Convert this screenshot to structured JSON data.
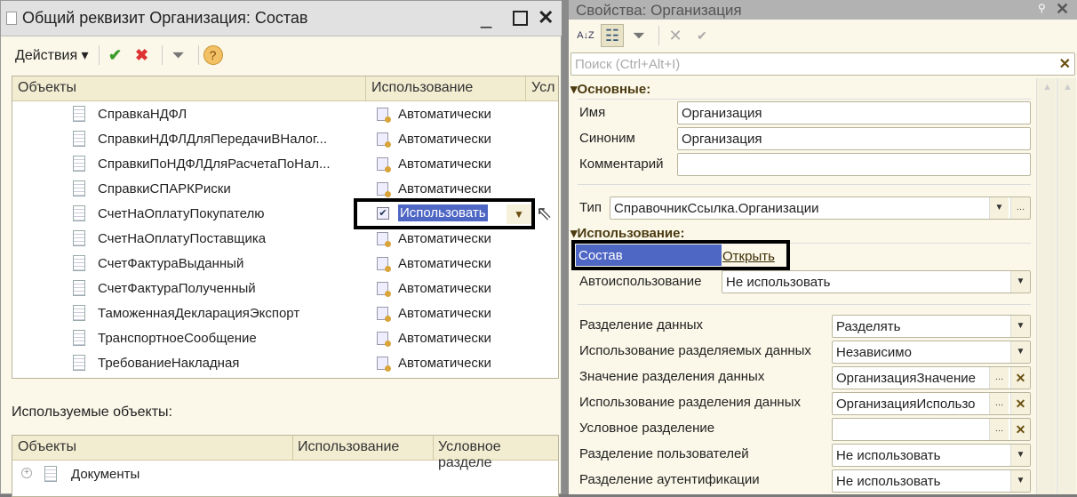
{
  "left_window": {
    "title": "Общий реквизит Организация: Состав",
    "toolbar": {
      "actions": "Действия ▾"
    },
    "grid": {
      "headers": [
        "Объекты",
        "Использование",
        "Усл"
      ],
      "rows": [
        {
          "name": "СправкаНДФЛ",
          "use": "Автоматически"
        },
        {
          "name": "СправкиНДФЛДляПередачиВНалог...",
          "use": "Автоматически"
        },
        {
          "name": "СправкиПоНДФЛДляРасчетаПоНал...",
          "use": "Автоматически"
        },
        {
          "name": "СправкиСПАРКРиски",
          "use": "Автоматически"
        },
        {
          "name": "СчетНаОплатуПокупателю",
          "use": "Использовать"
        },
        {
          "name": "СчетНаОплатуПоставщика",
          "use": "Автоматически"
        },
        {
          "name": "СчетФактураВыданный",
          "use": "Автоматически"
        },
        {
          "name": "СчетФактураПолученный",
          "use": "Автоматически"
        },
        {
          "name": "ТаможеннаяДекларацияЭкспорт",
          "use": "Автоматически"
        },
        {
          "name": "ТранспортноеСообщение",
          "use": "Автоматически"
        },
        {
          "name": "ТребованиеНакладная",
          "use": "Автоматически"
        }
      ]
    },
    "used_label": "Используемые объекты:",
    "used_grid": {
      "headers": [
        "Объекты",
        "Использование",
        "Условное разделе"
      ],
      "rows": [
        {
          "name": "Документы"
        }
      ]
    }
  },
  "right_window": {
    "title": "Свойства: Организация",
    "search_placeholder": "Поиск (Ctrl+Alt+I)",
    "sections": {
      "main": "Основные:",
      "usage": "Использование:"
    },
    "fields": {
      "name_label": "Имя",
      "name": "Организация",
      "synonym_label": "Синоним",
      "synonym": "Организация",
      "comment_label": "Комментарий",
      "comment": "",
      "type_label": "Тип",
      "type": "СправочникСсылка.Организации",
      "composition_label": "Состав",
      "composition_link": "Открыть",
      "autouse_label": "Автоиспользование",
      "autouse": "Не использовать"
    },
    "separation": [
      {
        "label": "Разделение данных",
        "value": "Разделять",
        "kind": "select"
      },
      {
        "label": "Использование разделяемых данных",
        "value": "Независимо",
        "kind": "select"
      },
      {
        "label": "Значение разделения данных",
        "value": "ОрганизацияЗначение",
        "kind": "pick"
      },
      {
        "label": "Использование разделения данных",
        "value": "ОрганизацияИспользо",
        "kind": "pick"
      },
      {
        "label": "Условное разделение",
        "value": "",
        "kind": "pick"
      },
      {
        "label": "Разделение пользователей",
        "value": "Не использовать",
        "kind": "select"
      },
      {
        "label": "Разделение аутентификации",
        "value": "Не использовать",
        "kind": "select"
      }
    ]
  },
  "colors": {
    "selection": "#4f67c4",
    "highlight_box": "#000000"
  }
}
